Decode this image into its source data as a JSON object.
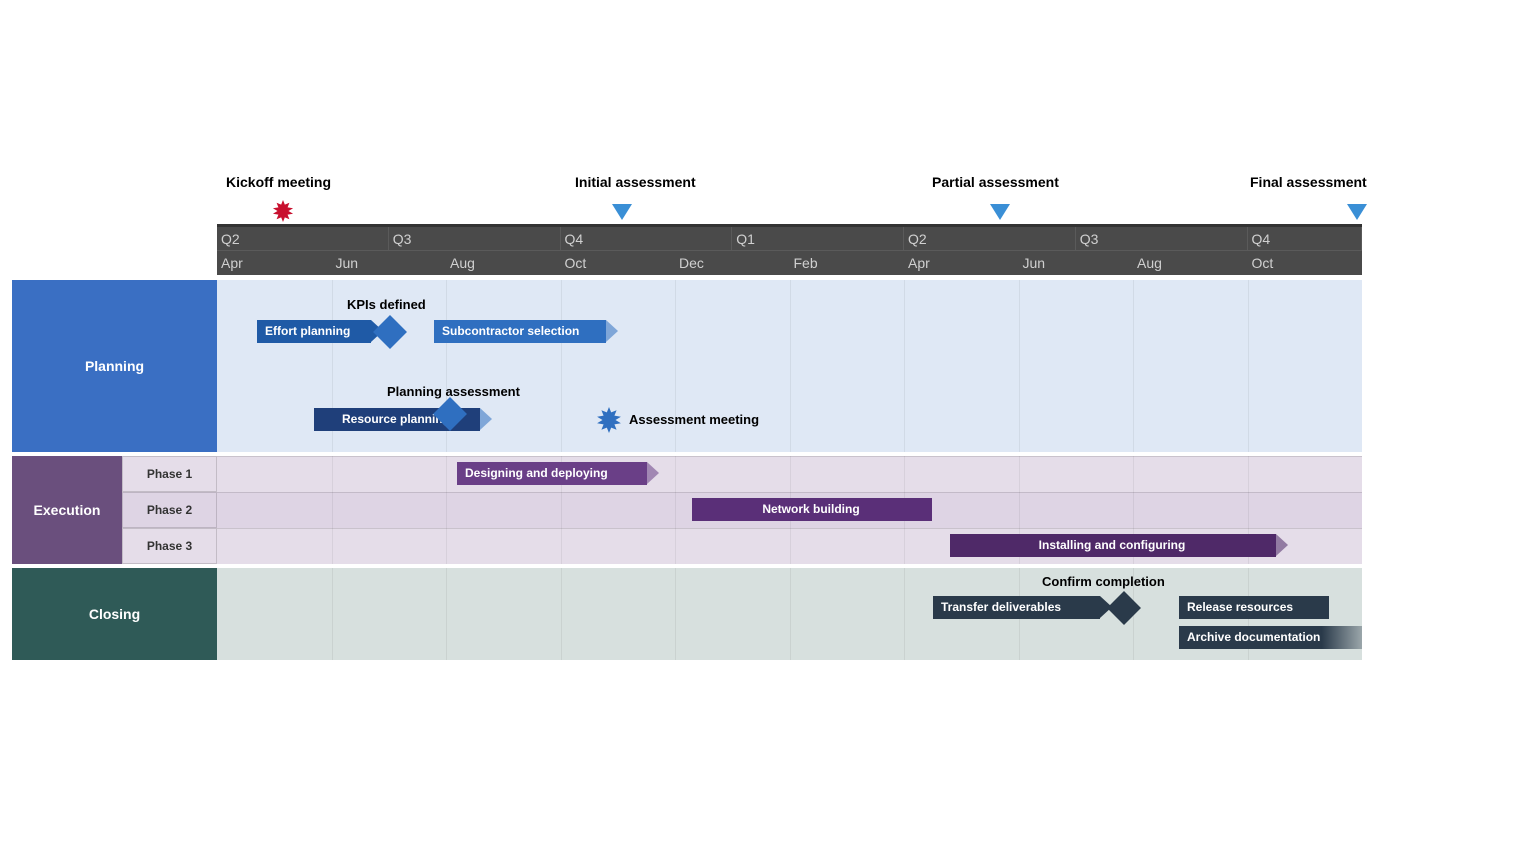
{
  "chart_data": {
    "type": "gantt",
    "time_axis": {
      "start_month": "Apr",
      "total_months": 20,
      "quarters": [
        {
          "label": "Q2",
          "start_month_index": 0
        },
        {
          "label": "Q3",
          "start_month_index": 3
        },
        {
          "label": "Q4",
          "start_month_index": 6
        },
        {
          "label": "Q1",
          "start_month_index": 9
        },
        {
          "label": "Q2",
          "start_month_index": 12
        },
        {
          "label": "Q3",
          "start_month_index": 15
        },
        {
          "label": "Q4",
          "start_month_index": 18
        }
      ],
      "month_labels": [
        "Apr",
        "",
        "Jun",
        "",
        "Aug",
        "",
        "Oct",
        "",
        "Dec",
        "",
        "Feb",
        "",
        "Apr",
        "",
        "Jun",
        "",
        "Aug",
        "",
        "Oct",
        ""
      ]
    },
    "top_milestones": [
      {
        "label": "Kickoff meeting",
        "month_index": 1.0,
        "shape": "starburst",
        "color": "#c8102e"
      },
      {
        "label": "Initial assessment",
        "month_index": 7.0,
        "shape": "triangle",
        "color": "#3a8fd6"
      },
      {
        "label": "Partial assessment",
        "month_index": 13.6,
        "shape": "triangle",
        "color": "#3a8fd6"
      },
      {
        "label": "Final assessment",
        "month_index": 20.0,
        "shape": "triangle",
        "color": "#3a8fd6"
      }
    ],
    "swimlanes": [
      {
        "name": "Planning",
        "color_header": "#3a6fc3",
        "color_body": "#dfe8f5",
        "rows": 2,
        "tasks": [
          {
            "label": "Effort planning",
            "row": 0,
            "start": 0.7,
            "end": 2.7,
            "color": "#1f5aa6",
            "arrow": true
          },
          {
            "label": "Subcontractor selection",
            "row": 0,
            "start": 3.8,
            "end": 6.8,
            "color": "#2f6fc0",
            "arrow": true,
            "arrow_fade": true
          },
          {
            "label": "Resource planning",
            "row": 1,
            "start": 1.7,
            "end": 4.6,
            "color": "#1f3f7a",
            "arrow": true,
            "arrow_fade": true
          }
        ],
        "milestones": [
          {
            "label": "KPIs defined",
            "row": 0,
            "month_index": 3.0,
            "shape": "diamond",
            "color": "#2f6fc0"
          },
          {
            "label": "Planning assessment",
            "row": 1,
            "month_index": 4.0,
            "shape": "diamond",
            "color": "#2f6fc0"
          },
          {
            "label": "Assessment meeting",
            "row": 1,
            "month_index": 6.8,
            "shape": "starburst",
            "color": "#2f6fc0",
            "label_side": "right"
          }
        ]
      },
      {
        "name": "Execution",
        "color_header": "#6a4f7d",
        "color_body": "#e5dde9",
        "subphases": [
          "Phase 1",
          "Phase 2",
          "Phase 3"
        ],
        "rows": 3,
        "tasks": [
          {
            "label": "Designing and deploying",
            "row": 0,
            "start": 4.2,
            "end": 7.5,
            "color": "#6a3f87",
            "arrow": true,
            "arrow_fade": true
          },
          {
            "label": "Network building",
            "row": 1,
            "start": 8.3,
            "end": 12.5,
            "color": "#5a2f78",
            "arrow": false
          },
          {
            "label": "Installing and configuring",
            "row": 2,
            "start": 12.8,
            "end": 18.5,
            "color": "#4f2968",
            "arrow": true,
            "arrow_fade": true,
            "text_align": "center"
          }
        ]
      },
      {
        "name": "Closing",
        "color_header": "#2f5a57",
        "color_body": "#d7e0de",
        "rows": 2,
        "tasks": [
          {
            "label": "Transfer deliverables",
            "row": 0,
            "start": 12.5,
            "end": 15.4,
            "color": "#2a3a4a",
            "arrow": true
          },
          {
            "label": "Release resources",
            "row": 0,
            "start": 16.8,
            "end": 19.4,
            "color": "#2a3a4a",
            "arrow": false
          },
          {
            "label": "Archive documentation",
            "row": 1,
            "start": 16.8,
            "end": 20.0,
            "color": "#2a3a4a",
            "arrow": false,
            "fade_right": true
          }
        ],
        "milestones": [
          {
            "label": "Confirm completion",
            "row": 0,
            "month_index": 15.9,
            "shape": "diamond",
            "color": "#2a3a4a"
          }
        ]
      }
    ]
  },
  "top_milestones": {
    "0": {
      "label": "Kickoff meeting"
    },
    "1": {
      "label": "Initial assessment"
    },
    "2": {
      "label": "Partial assessment"
    },
    "3": {
      "label": "Final assessment"
    }
  },
  "quarters": {
    "0": "Q2",
    "1": "Q3",
    "2": "Q4",
    "3": "Q1",
    "4": "Q2",
    "5": "Q3",
    "6": "Q4"
  },
  "months": {
    "0": "Apr",
    "2": "Jun",
    "4": "Aug",
    "6": "Oct",
    "8": "Dec",
    "10": "Feb",
    "12": "Apr",
    "14": "Jun",
    "16": "Aug",
    "18": "Oct"
  },
  "lanes": {
    "planning": {
      "title": "Planning",
      "tasks": {
        "effort": "Effort planning",
        "sub": "Subcontractor selection",
        "resource": "Resource planning"
      },
      "milestones": {
        "kpis": "KPIs defined",
        "passess": "Planning assessment",
        "ameet": "Assessment meeting"
      }
    },
    "execution": {
      "title": "Execution",
      "phases": {
        "0": "Phase 1",
        "1": "Phase 2",
        "2": "Phase 3"
      },
      "tasks": {
        "design": "Designing and deploying",
        "network": "Network building",
        "install": "Installing and configuring"
      }
    },
    "closing": {
      "title": "Closing",
      "tasks": {
        "transfer": "Transfer deliverables",
        "release": "Release resources",
        "archive": "Archive documentation"
      },
      "milestones": {
        "confirm": "Confirm completion"
      }
    }
  }
}
